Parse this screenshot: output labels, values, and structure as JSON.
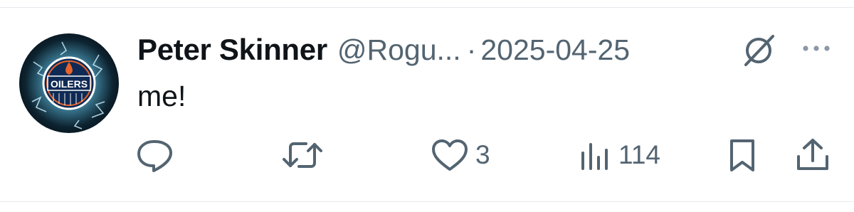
{
  "tweet": {
    "author_name": "Peter Skinner",
    "handle": "@Rogu...",
    "separator": "·",
    "date": "2025-04-25",
    "text": "me!",
    "avatar_logo_text": "OILERS"
  },
  "actions": {
    "reply_count": "",
    "retweet_count": "",
    "like_count": "3",
    "views_count": "114"
  },
  "icons": {
    "avatar": "oilers-logo-avatar",
    "grok": "grok-icon",
    "more": "more-dots-icon",
    "reply": "reply-bubble-icon",
    "retweet": "retweet-icon",
    "like": "heart-icon",
    "views": "bar-chart-icon",
    "bookmark": "bookmark-icon",
    "share": "share-upload-icon"
  },
  "colors": {
    "text_primary": "#0f1419",
    "text_secondary": "#536471",
    "divider": "#e6e9ec",
    "avatar_dark": "#0a1a24",
    "avatar_glow": "#7fc6e0",
    "logo_orange": "#e8642a",
    "logo_navy": "#0f2a55"
  }
}
